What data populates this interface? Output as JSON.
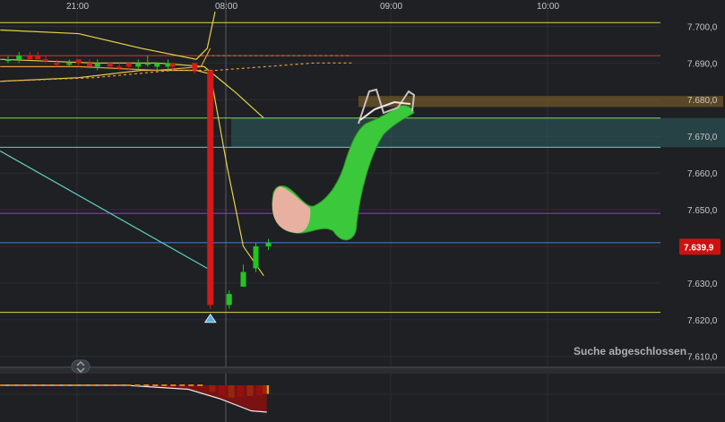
{
  "chart_data": {
    "type": "candlestick",
    "x_labels": [
      "21:00",
      "08:00",
      "09:00",
      "10:00"
    ],
    "x_label_slots": [
      0.0,
      1.0,
      2.0,
      3.0
    ],
    "y_ticks": [
      {
        "value": 7700,
        "label": "7.700,0"
      },
      {
        "value": 7690,
        "label": "7.690,0"
      },
      {
        "value": 7680,
        "label": "7.680,0"
      },
      {
        "value": 7670,
        "label": "7.670,0"
      },
      {
        "value": 7660,
        "label": "7.660,0"
      },
      {
        "value": 7650,
        "label": "7.650,0"
      },
      {
        "value": 7640,
        "label": "7.640,0"
      },
      {
        "value": 7630,
        "label": "7.630,0"
      },
      {
        "value": 7620,
        "label": "7.620,0"
      },
      {
        "value": 7610,
        "label": "7.610,0"
      }
    ],
    "ylim": [
      7607,
      7704
    ],
    "last_price": {
      "value": 7639.9,
      "label": "7.639,9",
      "color": "#cc1111"
    },
    "horizontal_lines": [
      {
        "value": 7701,
        "color": "#e6d24a"
      },
      {
        "value": 7692,
        "color": "#d23a3a"
      },
      {
        "value": 7675,
        "color": "#7ed957"
      },
      {
        "value": 7667,
        "color": "#5fd0c0"
      },
      {
        "value": 7649,
        "color": "#9b3bd6"
      },
      {
        "value": 7641,
        "color": "#4a7fe0"
      },
      {
        "value": 7622,
        "color": "#e6d24a"
      }
    ],
    "zones": [
      {
        "from": 7678,
        "to": 7681,
        "color": "#8a6a2a"
      },
      {
        "from": 7667,
        "to": 7675,
        "color": "#2f5f63"
      }
    ],
    "candles": [
      {
        "x": 0.05,
        "o": 7691,
        "h": 7692,
        "l": 7690,
        "c": 7691,
        "dir": "up"
      },
      {
        "x": 0.12,
        "o": 7692,
        "h": 7693,
        "l": 7690,
        "c": 7691,
        "dir": "up"
      },
      {
        "x": 0.19,
        "o": 7692,
        "h": 7693,
        "l": 7691,
        "c": 7691,
        "dir": "down"
      },
      {
        "x": 0.24,
        "o": 7692,
        "h": 7693,
        "l": 7691,
        "c": 7691,
        "dir": "down"
      },
      {
        "x": 0.29,
        "o": 7691,
        "h": 7692,
        "l": 7690,
        "c": 7691,
        "dir": "down"
      },
      {
        "x": 0.36,
        "o": 7690,
        "h": 7691,
        "l": 7689,
        "c": 7690,
        "dir": "down"
      },
      {
        "x": 0.44,
        "o": 7690,
        "h": 7691,
        "l": 7689,
        "c": 7690,
        "dir": "up"
      },
      {
        "x": 0.5,
        "o": 7691,
        "h": 7691,
        "l": 7689,
        "c": 7690,
        "dir": "down"
      },
      {
        "x": 0.57,
        "o": 7690,
        "h": 7691,
        "l": 7689,
        "c": 7689,
        "dir": "down"
      },
      {
        "x": 0.62,
        "o": 7689,
        "h": 7691,
        "l": 7688,
        "c": 7690,
        "dir": "up"
      },
      {
        "x": 0.7,
        "o": 7690,
        "h": 7690,
        "l": 7689,
        "c": 7689,
        "dir": "down"
      },
      {
        "x": 0.76,
        "o": 7689,
        "h": 7690,
        "l": 7688,
        "c": 7689,
        "dir": "down"
      },
      {
        "x": 0.82,
        "o": 7690,
        "h": 7690,
        "l": 7688,
        "c": 7689,
        "dir": "down"
      },
      {
        "x": 0.88,
        "o": 7689,
        "h": 7691,
        "l": 7688,
        "c": 7690,
        "dir": "up"
      },
      {
        "x": 0.94,
        "o": 7690,
        "h": 7692,
        "l": 7689,
        "c": 7690,
        "dir": "up"
      },
      {
        "x": 1.0,
        "o": 7690,
        "h": 7690,
        "l": 7688,
        "c": 7689,
        "dir": "up"
      },
      {
        "x": 1.07,
        "o": 7690,
        "h": 7691,
        "l": 7688,
        "c": 7689,
        "dir": "up"
      },
      {
        "x": 1.1,
        "o": 7690,
        "h": 7690,
        "l": 7688,
        "c": 7689,
        "dir": "down"
      },
      {
        "x": 1.24,
        "o": 7690,
        "h": 7690,
        "l": 7687,
        "c": 7688,
        "dir": "down"
      },
      {
        "x": 1.34,
        "o": 7688,
        "h": 7688,
        "l": 7623,
        "c": 7624,
        "dir": "down"
      },
      {
        "x": 1.46,
        "o": 7624,
        "h": 7628,
        "l": 7623,
        "c": 7627,
        "dir": "up"
      },
      {
        "x": 1.55,
        "o": 7629,
        "h": 7635,
        "l": 7629,
        "c": 7633,
        "dir": "up"
      },
      {
        "x": 1.63,
        "o": 7634,
        "h": 7641,
        "l": 7633,
        "c": 7640,
        "dir": "up"
      },
      {
        "x": 1.71,
        "o": 7640,
        "h": 7642,
        "l": 7639,
        "c": 7641,
        "dir": "up"
      }
    ],
    "series": [
      {
        "kind": "band-upper",
        "color": "#e6d24a",
        "points": [
          [
            0,
            7699
          ],
          [
            0.5,
            7698
          ],
          [
            0.9,
            7694
          ],
          [
            1.25,
            7691
          ],
          [
            1.32,
            7694
          ],
          [
            1.37,
            7704
          ]
        ]
      },
      {
        "kind": "band-lower",
        "color": "#e6d24a",
        "points": [
          [
            0,
            7685
          ],
          [
            0.5,
            7686
          ],
          [
            0.9,
            7688
          ],
          [
            1.25,
            7688
          ],
          [
            1.34,
            7687
          ],
          [
            1.45,
            7661
          ],
          [
            1.55,
            7640
          ],
          [
            1.68,
            7632
          ]
        ]
      },
      {
        "kind": "average",
        "color": "#e6d24a",
        "points": [
          [
            0,
            7691
          ],
          [
            0.6,
            7690
          ],
          [
            1.0,
            7690
          ],
          [
            1.3,
            7689
          ],
          [
            1.5,
            7682
          ],
          [
            1.68,
            7675
          ]
        ]
      },
      {
        "kind": "average",
        "color": "#e89a3a",
        "points": [
          [
            0,
            7689
          ],
          [
            0.5,
            7689
          ],
          [
            1.0,
            7688
          ],
          [
            1.28,
            7689
          ],
          [
            1.34,
            7694
          ]
        ]
      },
      {
        "kind": "average",
        "color": "#e89a3a",
        "points": [
          [
            0,
            7685
          ],
          [
            0.6,
            7686
          ],
          [
            1.1,
            7688
          ],
          [
            1.38,
            7688
          ],
          [
            2.0,
            7690
          ],
          [
            2.24,
            7690
          ]
        ],
        "dashed": true
      },
      {
        "kind": "average",
        "color": "#b07a2a",
        "points": [
          [
            1.28,
            7692
          ],
          [
            2.24,
            7692
          ]
        ],
        "dashed": true
      },
      {
        "kind": "trend",
        "color": "#5fd0c0",
        "points": [
          [
            0,
            7666
          ],
          [
            1.32,
            7634
          ]
        ]
      }
    ],
    "indicator": {
      "bars": [
        {
          "x": 1.35,
          "v": -0.45,
          "color": "#e07a10"
        },
        {
          "x": 1.41,
          "v": -0.7,
          "color": "#d21a10"
        },
        {
          "x": 1.47,
          "v": -0.85,
          "color": "#e0a010"
        },
        {
          "x": 1.53,
          "v": -0.8,
          "color": "#d21a10"
        },
        {
          "x": 1.59,
          "v": -0.75,
          "color": "#e0a010"
        },
        {
          "x": 1.65,
          "v": -0.7,
          "color": "#d21a10"
        },
        {
          "x": 1.69,
          "v": -0.6,
          "color": "#e0a010"
        }
      ],
      "line_points": [
        [
          0,
          0.0
        ],
        [
          0.8,
          0.0
        ],
        [
          1.2,
          -0.15
        ],
        [
          1.4,
          -0.5
        ],
        [
          1.6,
          -0.95
        ],
        [
          1.7,
          -1.0
        ]
      ],
      "dash_points": [
        [
          0,
          0.0
        ],
        [
          1.3,
          0.0
        ]
      ]
    }
  },
  "status": {
    "text": "Suche abgeschlossen"
  },
  "marker": {
    "kind": "triangle-up",
    "x": 1.34,
    "value": 7620.5,
    "color": "#5ab0d8"
  },
  "colors": {
    "background": "#1e2023",
    "grid": "#2b2e33",
    "separator": "#3a3d42",
    "up": "#22c522",
    "down": "#d21a1a"
  }
}
